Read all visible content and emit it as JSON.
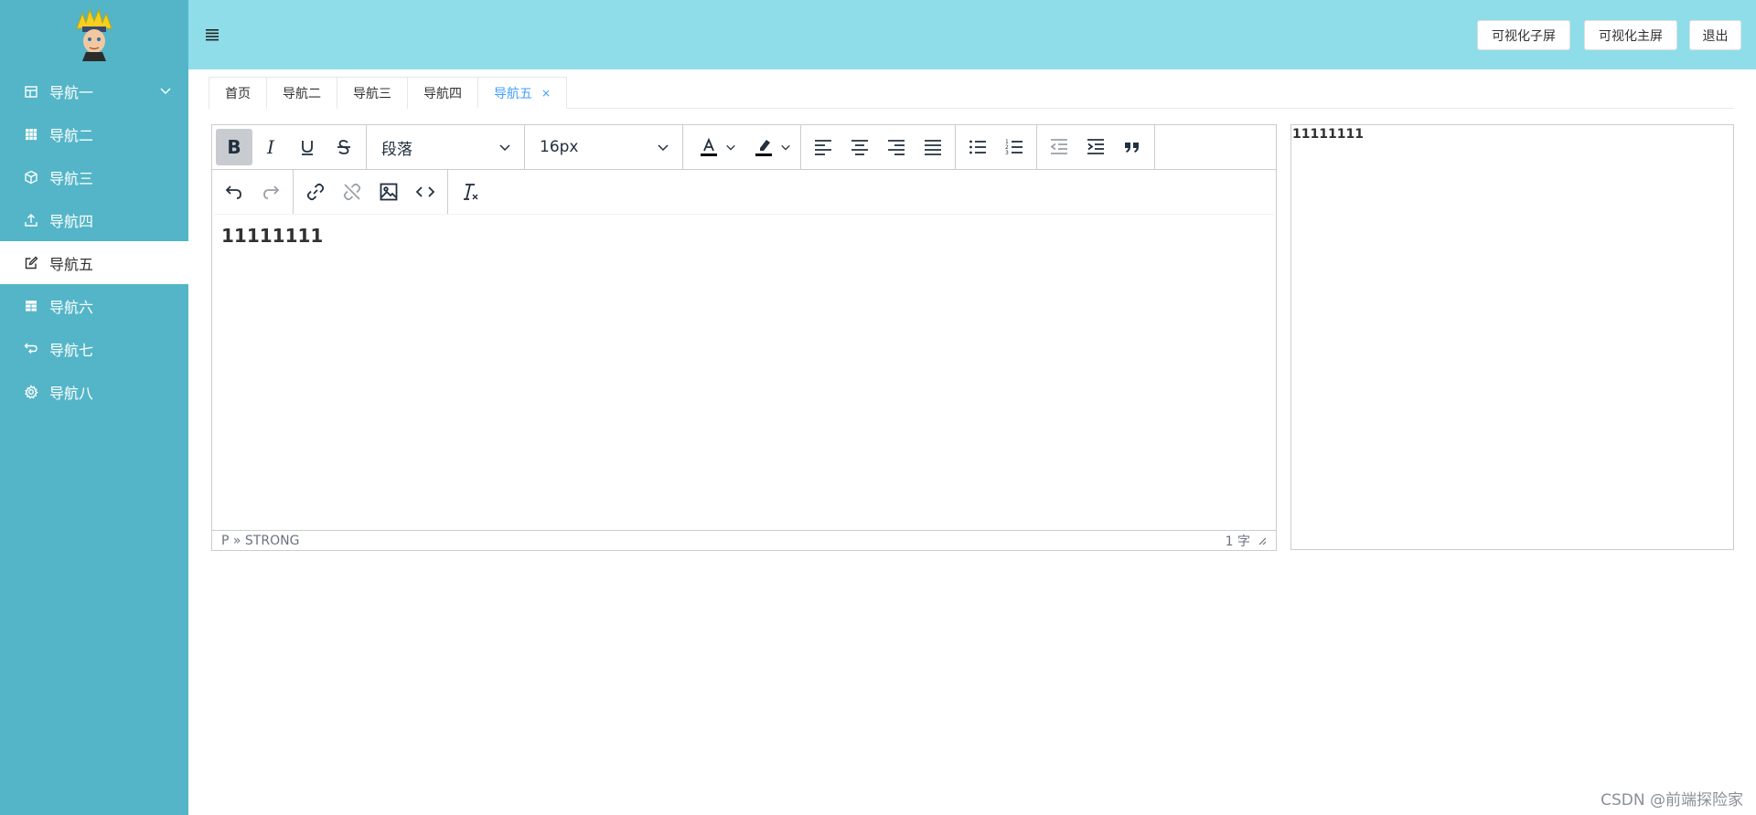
{
  "sidebar": {
    "items": [
      {
        "label": "导航一",
        "icon": "calendar-icon",
        "expandable": true,
        "active": false
      },
      {
        "label": "导航二",
        "icon": "grid-icon",
        "expandable": false,
        "active": false
      },
      {
        "label": "导航三",
        "icon": "box-icon",
        "expandable": false,
        "active": false
      },
      {
        "label": "导航四",
        "icon": "upload-icon",
        "expandable": false,
        "active": false
      },
      {
        "label": "导航五",
        "icon": "edit-icon",
        "expandable": false,
        "active": true
      },
      {
        "label": "导航六",
        "icon": "table-icon",
        "expandable": false,
        "active": false
      },
      {
        "label": "导航七",
        "icon": "refresh-icon",
        "expandable": false,
        "active": false
      },
      {
        "label": "导航八",
        "icon": "gear-icon",
        "expandable": false,
        "active": false
      }
    ]
  },
  "header": {
    "buttons": {
      "sub_screen": "可视化子屏",
      "main_screen": "可视化主屏",
      "logout": "退出"
    }
  },
  "tabs": [
    {
      "label": "首页",
      "active": false
    },
    {
      "label": "导航二",
      "active": false
    },
    {
      "label": "导航三",
      "active": false
    },
    {
      "label": "导航四",
      "active": false
    },
    {
      "label": "导航五",
      "active": true,
      "close": "×"
    }
  ],
  "editor": {
    "block_format": "段落",
    "font_size": "16px",
    "content": "11111111",
    "status_path": "P » STRONG",
    "word_count": "1 字"
  },
  "preview": {
    "content": "11111111"
  },
  "watermark": "CSDN @前端探险家",
  "colors": {
    "sidebar": "#53b5c7",
    "header": "#8edde9",
    "active_tab": "#409eff"
  }
}
